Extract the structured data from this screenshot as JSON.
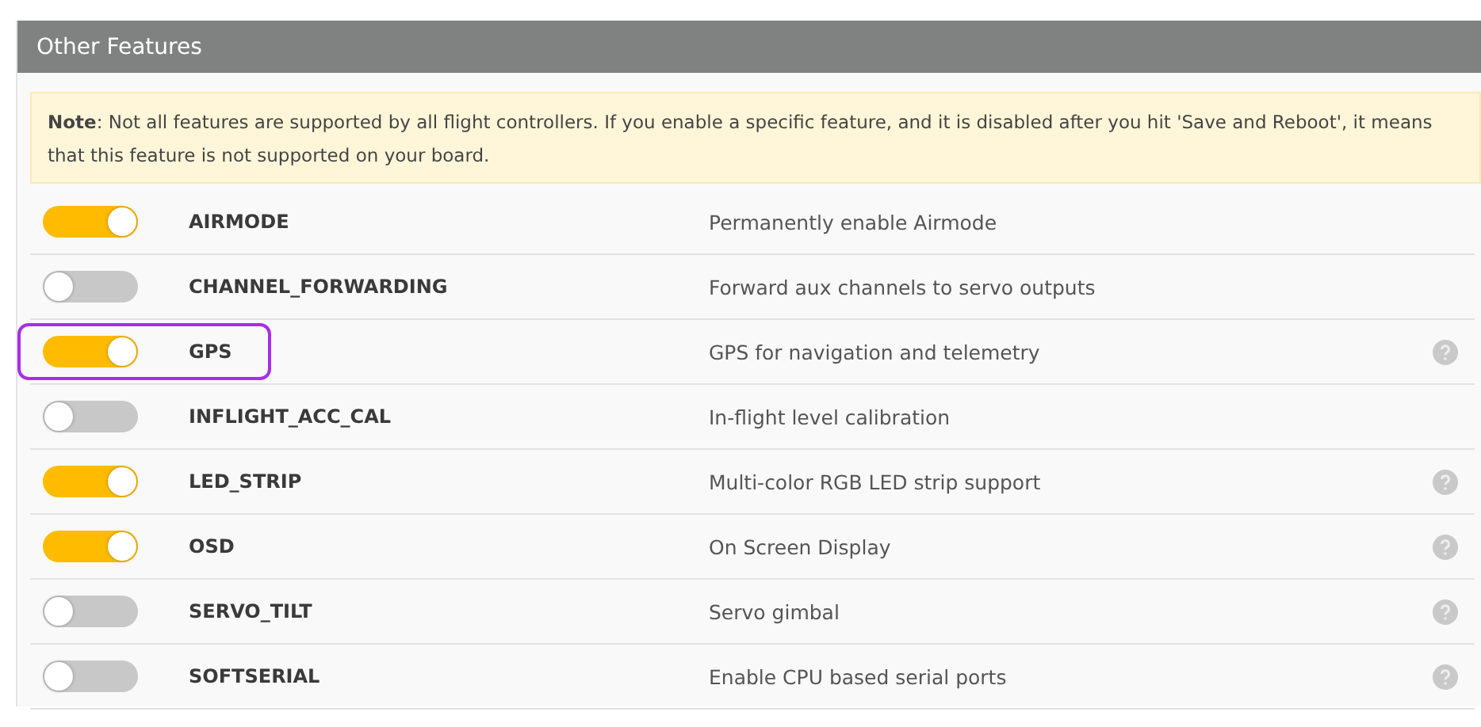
{
  "panel": {
    "title": "Other Features"
  },
  "note": {
    "text": "**Note**: Not all features are supported by all flight controllers. If you enable a specific feature, and it is disabled after you hit 'Save and Reboot', it means that this feature is not supported on your board."
  },
  "features": [
    {
      "name": "AIRMODE",
      "description": "Permanently enable Airmode",
      "on": true,
      "help": false,
      "highlighted": false
    },
    {
      "name": "CHANNEL_FORWARDING",
      "description": "Forward aux channels to servo outputs",
      "on": false,
      "help": false,
      "highlighted": false
    },
    {
      "name": "GPS",
      "description": "GPS for navigation and telemetry",
      "on": true,
      "help": true,
      "highlighted": true
    },
    {
      "name": "INFLIGHT_ACC_CAL",
      "description": "In-flight level calibration",
      "on": false,
      "help": false,
      "highlighted": false
    },
    {
      "name": "LED_STRIP",
      "description": "Multi-color RGB LED strip support",
      "on": true,
      "help": true,
      "highlighted": false
    },
    {
      "name": "OSD",
      "description": "On Screen Display",
      "on": true,
      "help": true,
      "highlighted": false
    },
    {
      "name": "SERVO_TILT",
      "description": "Servo gimbal",
      "on": false,
      "help": true,
      "highlighted": false
    },
    {
      "name": "SOFTSERIAL",
      "description": "Enable CPU based serial ports",
      "on": false,
      "help": true,
      "highlighted": false
    }
  ]
}
